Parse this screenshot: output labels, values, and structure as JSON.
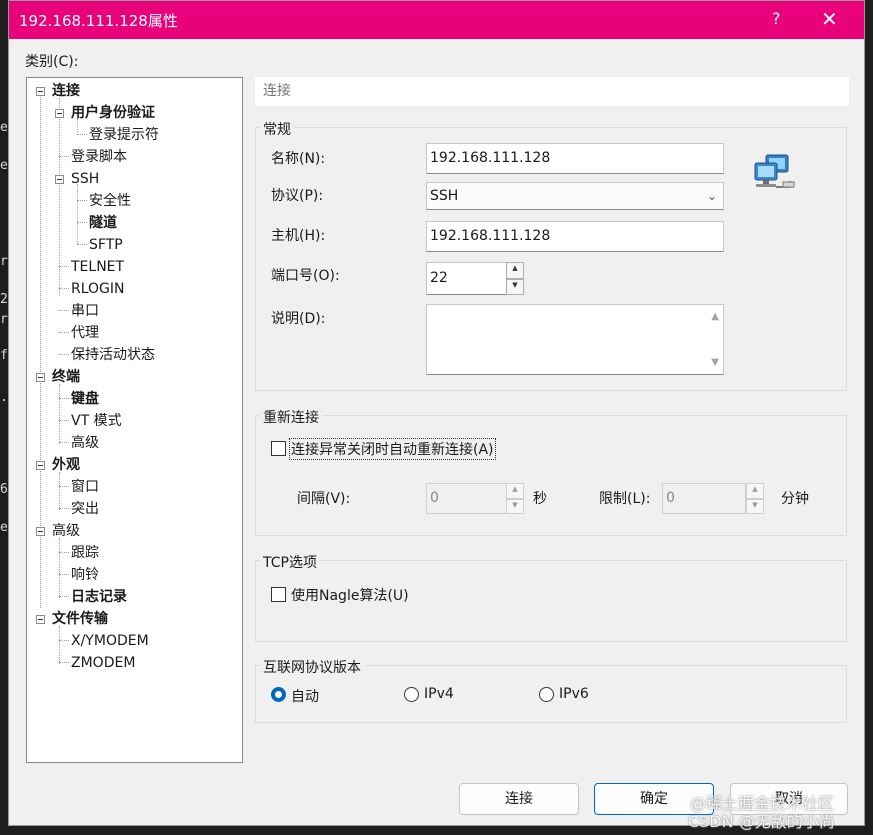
{
  "background_text": [
    "e",
    "e",
    "r",
    "2",
    "r",
    "f",
    ".",
    "6",
    "e"
  ],
  "dialog": {
    "title": "192.168.111.128属性",
    "help_glyph": "?",
    "close_glyph": "✕",
    "category_label": "类别(C):"
  },
  "tree": {
    "items": [
      {
        "label": "连接"
      },
      {
        "label": "用户身份验证"
      },
      {
        "label": "登录提示符"
      },
      {
        "label": "登录脚本"
      },
      {
        "label": "SSH"
      },
      {
        "label": "安全性"
      },
      {
        "label": "隧道"
      },
      {
        "label": "SFTP"
      },
      {
        "label": "TELNET"
      },
      {
        "label": "RLOGIN"
      },
      {
        "label": "串口"
      },
      {
        "label": "代理"
      },
      {
        "label": "保持活动状态"
      },
      {
        "label": "终端"
      },
      {
        "label": "键盘"
      },
      {
        "label": "VT 模式"
      },
      {
        "label": "高级"
      },
      {
        "label": "外观"
      },
      {
        "label": "窗口"
      },
      {
        "label": "突出"
      },
      {
        "label": "高级"
      },
      {
        "label": "跟踪"
      },
      {
        "label": "响铃"
      },
      {
        "label": "日志记录"
      },
      {
        "label": "文件传输"
      },
      {
        "label": "X/YMODEM"
      },
      {
        "label": "ZMODEM"
      }
    ]
  },
  "section_title": "连接",
  "general": {
    "title": "常规",
    "name_label": "名称(N):",
    "name_value": "192.168.111.128",
    "protocol_label": "协议(P):",
    "protocol_value": "SSH",
    "host_label": "主机(H):",
    "host_value": "192.168.111.128",
    "port_label": "端口号(O):",
    "port_value": "22",
    "desc_label": "说明(D):",
    "desc_value": ""
  },
  "reconnect": {
    "title": "重新连接",
    "checkbox_label": "连接异常关闭时自动重新连接(A)",
    "interval_label": "间隔(V):",
    "interval_value": "0",
    "interval_unit": "秒",
    "limit_label": "限制(L):",
    "limit_value": "0",
    "limit_unit": "分钟"
  },
  "tcp": {
    "title": "TCP选项",
    "nagle_label": "使用Nagle算法(U)"
  },
  "ip_version": {
    "title": "互联网协议版本",
    "options": [
      "自动",
      "IPv4",
      "IPv6"
    ],
    "selected": "自动"
  },
  "buttons": {
    "connect": "连接",
    "ok": "确定",
    "cancel": "取消"
  },
  "watermark": [
    "@稀土掘金技术社区",
    "CSDN @无敌的小尚"
  ],
  "colors": {
    "titlebar": "#e8017b",
    "accent": "#0067c0"
  }
}
